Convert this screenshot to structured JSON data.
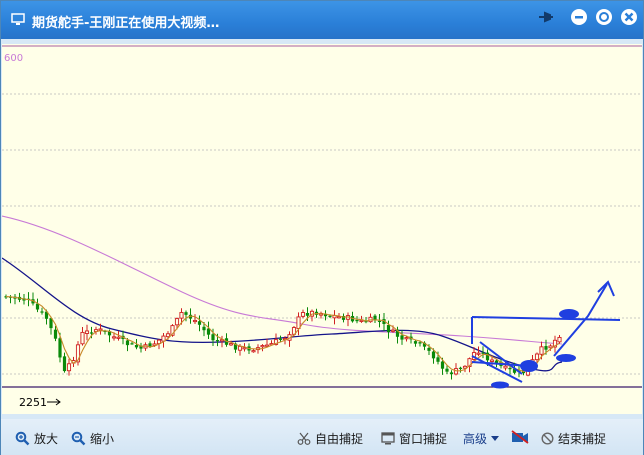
{
  "window": {
    "title": "期货舵手-王刚正在使用大视频…"
  },
  "chart": {
    "top_tick_fragment": "600",
    "low_price_label": "2251",
    "colors": {
      "background": "#ffffe8",
      "up": "#d02020",
      "down": "#0a8a0a",
      "ma_short": "#c88a2a",
      "ma_mid": "#14148a",
      "ma_long": "#c87ad6",
      "annotation": "#1f3fe0"
    }
  },
  "toolbar": {
    "zoom_in": "放大",
    "zoom_out": "缩小",
    "free_capture": "自由捕捉",
    "window_capture": "窗口捕捉",
    "advanced": "高级",
    "end_capture": "结束捕捉"
  }
}
